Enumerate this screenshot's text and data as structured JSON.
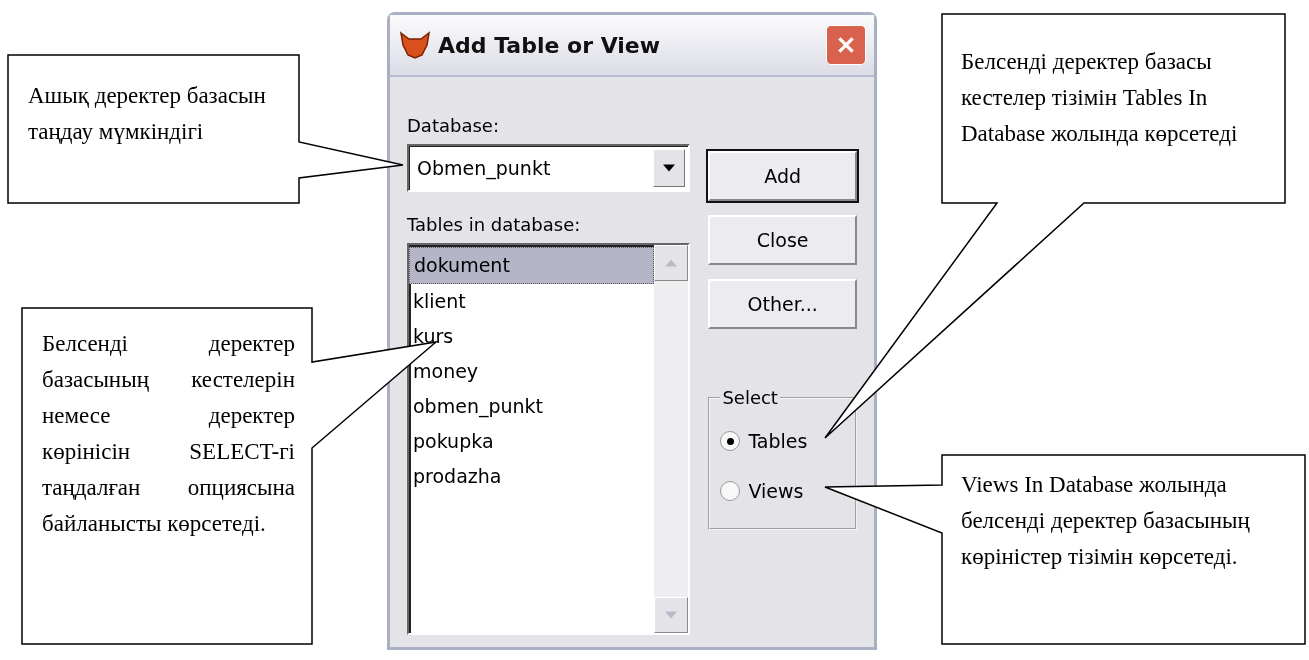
{
  "dialog": {
    "title": "Add Table or View",
    "database_label": "Database:",
    "database": {
      "value": "Obmen_punkt"
    },
    "tables_label": "Tables in database:",
    "tables": [
      {
        "label": "dokument",
        "selected": true
      },
      {
        "label": "klient",
        "selected": false
      },
      {
        "label": "kurs",
        "selected": false
      },
      {
        "label": "money",
        "selected": false
      },
      {
        "label": "obmen_punkt",
        "selected": false
      },
      {
        "label": "pokupka",
        "selected": false
      },
      {
        "label": "prodazha",
        "selected": false
      }
    ],
    "buttons": [
      {
        "label": "Add",
        "default": true
      },
      {
        "label": "Close",
        "default": false
      },
      {
        "label": "Other...",
        "default": false
      }
    ],
    "select_group": {
      "label": "Select",
      "options": [
        {
          "label": "Tables",
          "selected": true
        },
        {
          "label": "Views",
          "selected": false
        }
      ]
    }
  },
  "callouts": [
    {
      "text": "Ашық деректер базасын таңдау мүмкіндігі"
    },
    {
      "text": "Белсенді деректер базасының кестелерін немесе деректер көрінісін SELECT-гі таңдалған опциясына байланысты көрсетеді."
    },
    {
      "text": "Белсенді деректер базасы кестелер тізімін Tables In Database жолында көрсетеді"
    },
    {
      "text": "Views In Database жолында белсенді деректер базасының көріністер тізімін көрсетеді."
    }
  ]
}
